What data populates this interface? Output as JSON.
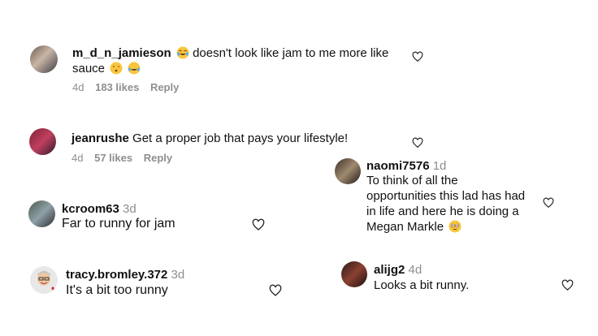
{
  "comments": [
    {
      "user": "m_d_n_jamieson",
      "text_line1": "doesn't look like jam to me more like",
      "text_line2": "sauce",
      "age": "4d",
      "likes": "183 likes",
      "reply": "Reply"
    },
    {
      "user": "jeanrushe",
      "text": "Get a proper job that pays your lifestyle!",
      "age": "4d",
      "likes": "57 likes",
      "reply": "Reply"
    },
    {
      "user": "naomi7576",
      "age": "1d",
      "text_lines": [
        "To think of all the",
        "opportunities this lad has had",
        "in life and here he is doing a",
        "Megan Markle"
      ]
    },
    {
      "user": "kcroom63",
      "age": "3d",
      "text": "Far to runny for jam"
    },
    {
      "user": "tracy.bromley.372",
      "age": "3d",
      "text": "It's a bit too runny"
    },
    {
      "user": "alijg2",
      "age": "4d",
      "text": "Looks a bit runny."
    }
  ],
  "icons": {
    "like": "heart-outline-icon",
    "emoji_laugh": "tears-of-joy-emoji",
    "emoji_kiss": "face-blowing-kiss-emoji",
    "emoji_flushed": "flushed-face-emoji"
  }
}
